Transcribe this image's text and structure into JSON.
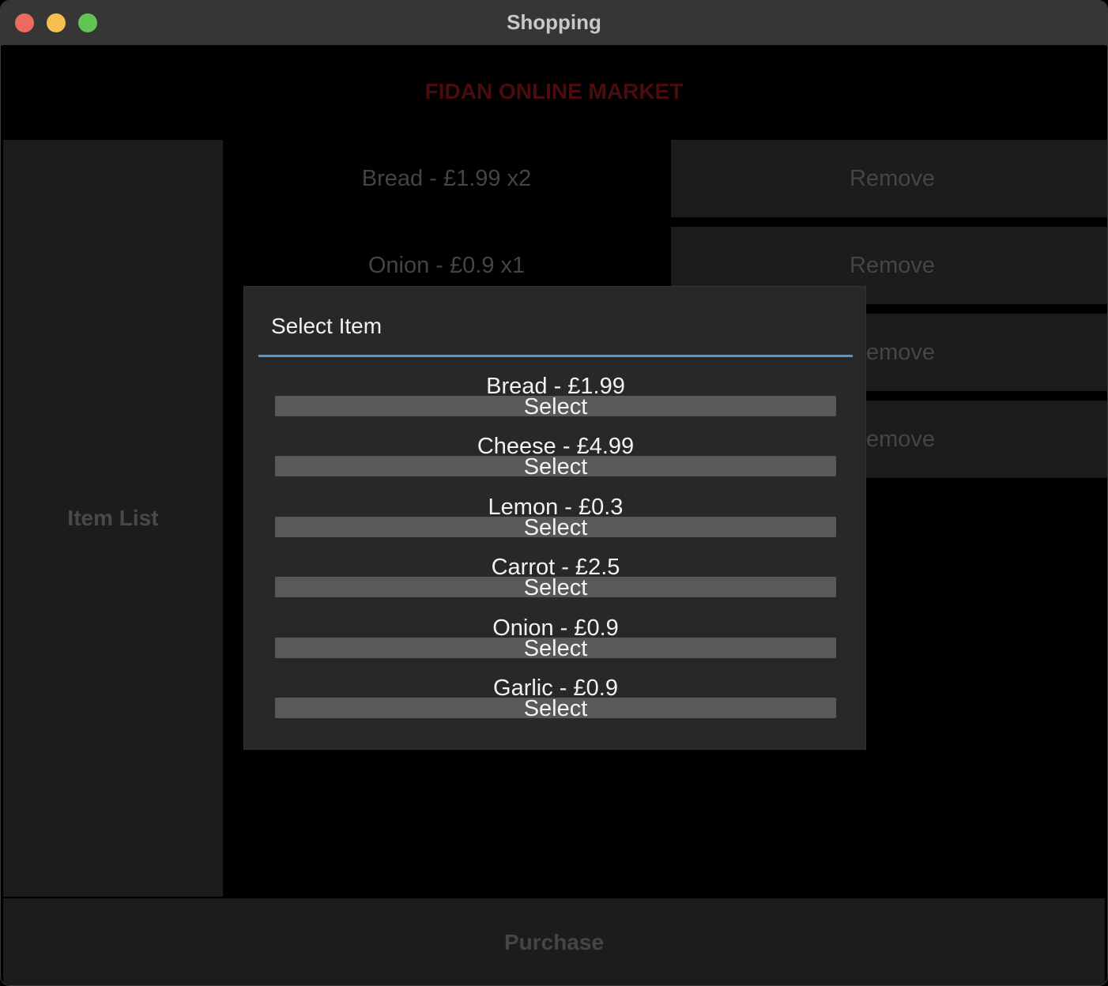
{
  "window": {
    "title": "Shopping"
  },
  "header": {
    "market_name": "FIDAN ONLINE MARKET"
  },
  "sidebar": {
    "item_list_label": "Item List"
  },
  "cart": {
    "rows": [
      {
        "label": "Bread - £1.99 x2",
        "remove_label": "Remove"
      },
      {
        "label": "Onion - £0.9 x1",
        "remove_label": "Remove"
      },
      {
        "label": "",
        "remove_label": "Remove"
      },
      {
        "label": "",
        "remove_label": "Remove"
      }
    ]
  },
  "footer": {
    "purchase_label": "Purchase"
  },
  "dialog": {
    "title": "Select Item",
    "options": [
      {
        "label": "Bread - £1.99",
        "button": "Select"
      },
      {
        "label": "Cheese - £4.99",
        "button": "Select"
      },
      {
        "label": "Lemon - £0.3",
        "button": "Select"
      },
      {
        "label": "Carrot - £2.5",
        "button": "Select"
      },
      {
        "label": "Onion - £0.9",
        "button": "Select"
      },
      {
        "label": "Garlic - £0.9",
        "button": "Select"
      }
    ]
  },
  "colors": {
    "accent_divider": "#4a9bd9",
    "market_title": "#4a0c0c",
    "traffic_close": "#ed6a5e",
    "traffic_minimize": "#f4bf4f",
    "traffic_maximize": "#61c554"
  }
}
